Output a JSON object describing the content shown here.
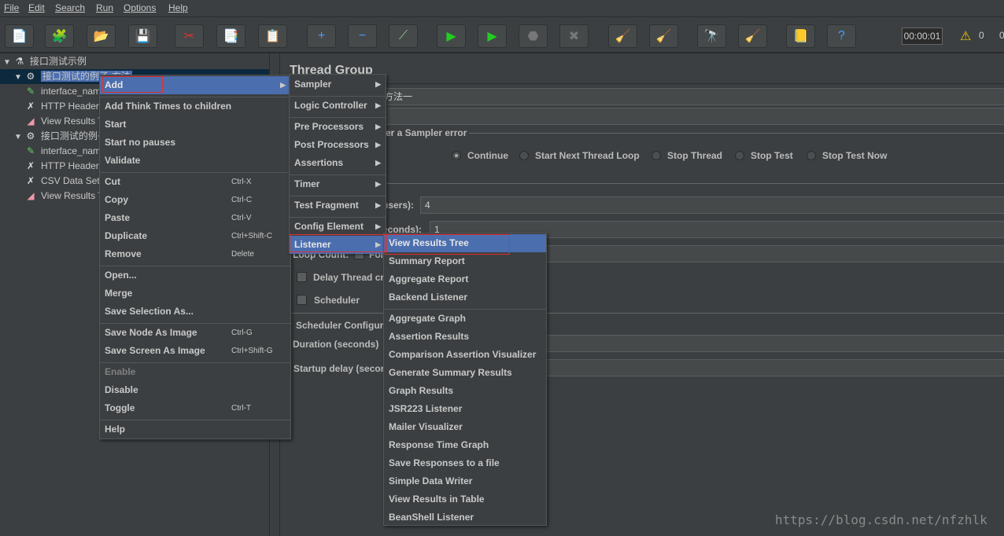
{
  "menubar": [
    "File",
    "Edit",
    "Search",
    "Run",
    "Options",
    "Help"
  ],
  "toolbar": {
    "icons": [
      "new-icon",
      "templates-icon",
      "open-icon",
      "save-icon",
      "cut-icon",
      "copy-icon",
      "paste-icon",
      "expand-icon",
      "collapse-icon",
      "toggle-icon",
      "start-icon",
      "start-no-pause-icon",
      "stop-icon",
      "shutdown-icon",
      "clear-icon",
      "clear-all-icon",
      "search-icon",
      "reset-search-icon",
      "function-helper-icon",
      "help-icon"
    ],
    "glyphs": [
      "📄",
      "🧩",
      "📂",
      "💾",
      "✂",
      "📑",
      "📋",
      "+",
      "−",
      "⟋",
      "▶",
      "▶",
      "⬣",
      "✖",
      "🧹",
      "🧹",
      "🔭",
      "🧹",
      "📒",
      "?"
    ],
    "timer": "00:00:01",
    "warnings": "0",
    "threads": "0"
  },
  "tree": [
    {
      "label": "接口测试示例",
      "icon": "test-plan-icon",
      "glyph": "⚗",
      "indent": 0,
      "arrow": "▼"
    },
    {
      "label": "接口测试的例子-方法",
      "icon": "thread-group-icon",
      "glyph": "⚙",
      "indent": 1,
      "arrow": "▼",
      "selected": true
    },
    {
      "label": "interface_name",
      "icon": "sampler-icon",
      "glyph": "✎",
      "indent": 2
    },
    {
      "label": "HTTP Header Manager",
      "icon": "config-icon",
      "glyph": "✗",
      "indent": 2
    },
    {
      "label": "View Results Tree",
      "icon": "listener-icon",
      "glyph": "◢",
      "indent": 2
    },
    {
      "label": "接口测试的例子",
      "icon": "thread-group-icon",
      "glyph": "⚙",
      "indent": 1,
      "arrow": "▼"
    },
    {
      "label": "interface_name",
      "icon": "sampler-icon",
      "glyph": "✎",
      "indent": 2
    },
    {
      "label": "HTTP Header Manager",
      "icon": "config-icon",
      "glyph": "✗",
      "indent": 2
    },
    {
      "label": "CSV Data Set Config",
      "icon": "config-icon",
      "glyph": "✗",
      "indent": 2
    },
    {
      "label": "View Results Tree",
      "icon": "listener-icon",
      "glyph": "◢",
      "indent": 2
    }
  ],
  "panel": {
    "title": "Thread Group",
    "name_value": "子-方法一",
    "error_label": "ter a Sampler error",
    "radios": [
      {
        "label": "Continue",
        "checked": true
      },
      {
        "label": "Start Next Thread Loop"
      },
      {
        "label": "Stop Thread"
      },
      {
        "label": "Stop Test"
      },
      {
        "label": "Stop Test Now"
      }
    ],
    "threads_label": "users):",
    "threads_value": "4",
    "rampup_label": "econds):",
    "rampup_value": "1",
    "loop_label": "Loop Count:",
    "loop_forever": "For",
    "delay_label": "Delay Thread cr",
    "scheduler_label": "Scheduler",
    "sched_config_label": "Scheduler Configura",
    "duration_label": "Duration (seconds)",
    "startup_label": "Startup delay (secon"
  },
  "context_menu": [
    {
      "label": "Add",
      "sub": true,
      "hl": true
    },
    {
      "sep": true
    },
    {
      "label": "Add Think Times to children"
    },
    {
      "label": "Start"
    },
    {
      "label": "Start no pauses"
    },
    {
      "label": "Validate"
    },
    {
      "sep": true
    },
    {
      "label": "Cut",
      "shortcut": "Ctrl-X"
    },
    {
      "label": "Copy",
      "shortcut": "Ctrl-C"
    },
    {
      "label": "Paste",
      "shortcut": "Ctrl-V"
    },
    {
      "label": "Duplicate",
      "shortcut": "Ctrl+Shift-C"
    },
    {
      "label": "Remove",
      "shortcut": "Delete"
    },
    {
      "sep": true
    },
    {
      "label": "Open..."
    },
    {
      "label": "Merge"
    },
    {
      "label": "Save Selection As..."
    },
    {
      "sep": true
    },
    {
      "label": "Save Node As Image",
      "shortcut": "Ctrl-G"
    },
    {
      "label": "Save Screen As Image",
      "shortcut": "Ctrl+Shift-G"
    },
    {
      "sep": true
    },
    {
      "label": "Enable",
      "disabled": true
    },
    {
      "label": "Disable"
    },
    {
      "label": "Toggle",
      "shortcut": "Ctrl-T"
    },
    {
      "sep": true
    },
    {
      "label": "Help"
    }
  ],
  "add_menu": [
    {
      "label": "Sampler",
      "sub": true
    },
    {
      "sep": true
    },
    {
      "label": "Logic Controller",
      "sub": true
    },
    {
      "sep": true
    },
    {
      "label": "Pre Processors",
      "sub": true
    },
    {
      "label": "Post Processors",
      "sub": true
    },
    {
      "label": "Assertions",
      "sub": true
    },
    {
      "sep": true
    },
    {
      "label": "Timer",
      "sub": true
    },
    {
      "sep": true
    },
    {
      "label": "Test Fragment",
      "sub": true
    },
    {
      "sep": true
    },
    {
      "label": "Config Element",
      "sub": true
    },
    {
      "label": "Listener",
      "sub": true,
      "hl": true
    }
  ],
  "listener_menu": [
    {
      "label": "View Results Tree",
      "hl": true
    },
    {
      "label": "Summary Report"
    },
    {
      "label": "Aggregate Report"
    },
    {
      "label": "Backend Listener"
    },
    {
      "sep": true
    },
    {
      "label": "Aggregate Graph"
    },
    {
      "label": "Assertion Results"
    },
    {
      "label": "Comparison Assertion Visualizer"
    },
    {
      "label": "Generate Summary Results"
    },
    {
      "label": "Graph Results"
    },
    {
      "label": "JSR223 Listener"
    },
    {
      "label": "Mailer Visualizer"
    },
    {
      "label": "Response Time Graph"
    },
    {
      "label": "Save Responses to a file"
    },
    {
      "label": "Simple Data Writer"
    },
    {
      "label": "View Results in Table"
    },
    {
      "label": "BeanShell Listener"
    }
  ],
  "watermark": "https://blog.csdn.net/nfzhlk",
  "colors": {
    "highlight": "#4b6eaf",
    "background": "#3c3f41",
    "annotation": "#e03030"
  }
}
